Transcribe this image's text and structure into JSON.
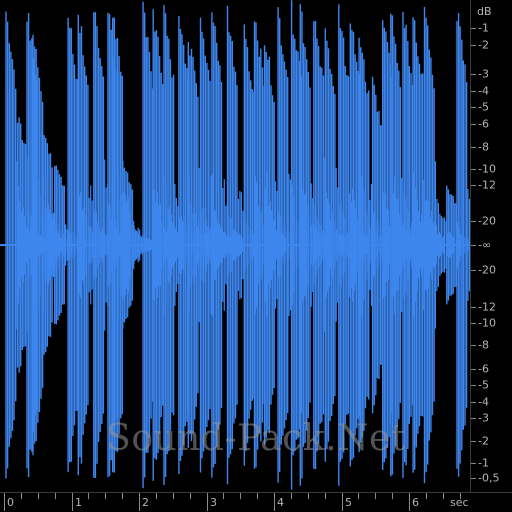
{
  "colors": {
    "waveform": "#3d86ee",
    "background": "#000000",
    "scale_text": "#b4b4b4"
  },
  "db_scale": {
    "unit": "dB",
    "labels": [
      "-1",
      "-2",
      "-3",
      "-4",
      "-5",
      "-6",
      "-8",
      "-10",
      "-12",
      "-20",
      "-∞",
      "-20",
      "-12",
      "-10",
      "-8",
      "-6",
      "-5",
      "-4",
      "-3",
      "-2",
      "-1",
      "-0,5"
    ]
  },
  "time_ruler": {
    "labels": [
      "0",
      "1",
      "2",
      "3",
      "4",
      "5",
      "6"
    ],
    "unit": "sec"
  },
  "watermark": "Sound-Pack.Net",
  "waveform": {
    "description_values": "relative amplitude bursts across 0–7 sec",
    "bursts": [
      {
        "t": 0.02,
        "amp": 1.0
      },
      {
        "t": 0.19,
        "amp": 0.55
      },
      {
        "t": 0.33,
        "amp": 1.0
      },
      {
        "t": 0.42,
        "amp": 0.9
      },
      {
        "t": 0.56,
        "amp": 0.5
      },
      {
        "t": 0.74,
        "amp": 0.35
      },
      {
        "t": 0.94,
        "amp": 1.0
      },
      {
        "t": 1.09,
        "amp": 1.0
      },
      {
        "t": 1.32,
        "amp": 1.0
      },
      {
        "t": 1.53,
        "amp": 1.0
      },
      {
        "t": 1.6,
        "amp": 1.0
      },
      {
        "t": 1.75,
        "amp": 0.35
      },
      {
        "t": 2.05,
        "amp": 1.0
      },
      {
        "t": 2.2,
        "amp": 1.0
      },
      {
        "t": 2.36,
        "amp": 1.0
      },
      {
        "t": 2.58,
        "amp": 1.0
      },
      {
        "t": 2.72,
        "amp": 0.9
      },
      {
        "t": 2.9,
        "amp": 1.0
      },
      {
        "t": 3.07,
        "amp": 1.0
      },
      {
        "t": 3.3,
        "amp": 1.0
      },
      {
        "t": 3.55,
        "amp": 0.9
      },
      {
        "t": 3.7,
        "amp": 1.0
      },
      {
        "t": 3.85,
        "amp": 0.9
      },
      {
        "t": 4.05,
        "amp": 1.0
      },
      {
        "t": 4.25,
        "amp": 1.0
      },
      {
        "t": 4.38,
        "amp": 1.0
      },
      {
        "t": 4.58,
        "amp": 1.0
      },
      {
        "t": 4.75,
        "amp": 0.9
      },
      {
        "t": 4.95,
        "amp": 1.0
      },
      {
        "t": 5.12,
        "amp": 1.0
      },
      {
        "t": 5.25,
        "amp": 0.9
      },
      {
        "t": 5.45,
        "amp": 0.7
      },
      {
        "t": 5.6,
        "amp": 1.0
      },
      {
        "t": 5.72,
        "amp": 1.0
      },
      {
        "t": 5.9,
        "amp": 1.0
      },
      {
        "t": 6.05,
        "amp": 1.0
      },
      {
        "t": 6.22,
        "amp": 1.0
      },
      {
        "t": 6.55,
        "amp": 0.25
      },
      {
        "t": 6.7,
        "amp": 1.0
      }
    ]
  }
}
